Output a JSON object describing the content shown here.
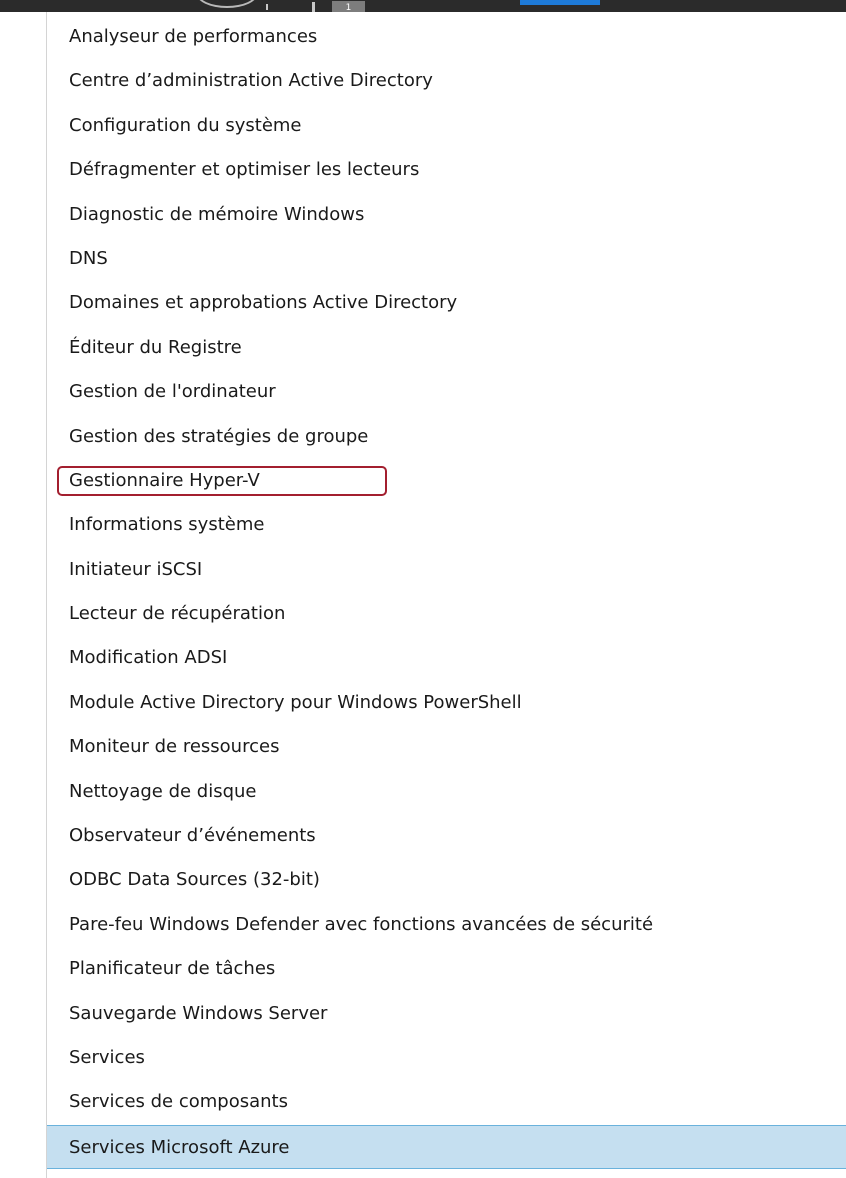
{
  "taskbar": {
    "badge_text": "1",
    "accent_color": "#1e7ad8"
  },
  "menu": {
    "highlight_color": "#a31f2f",
    "selected_color": "#c5dff0",
    "items": [
      {
        "label": "Analyseur de performances"
      },
      {
        "label": "Centre d’administration Active Directory"
      },
      {
        "label": "Configuration du système"
      },
      {
        "label": "Défragmenter et optimiser les lecteurs"
      },
      {
        "label": "Diagnostic de mémoire Windows"
      },
      {
        "label": "DNS"
      },
      {
        "label": "Domaines et approbations Active Directory"
      },
      {
        "label": "Éditeur du Registre"
      },
      {
        "label": "Gestion de l'ordinateur"
      },
      {
        "label": "Gestion des stratégies de groupe"
      },
      {
        "label": "Gestionnaire Hyper-V",
        "highlighted": true
      },
      {
        "label": "Informations système"
      },
      {
        "label": "Initiateur iSCSI"
      },
      {
        "label": "Lecteur de récupération"
      },
      {
        "label": "Modification ADSI"
      },
      {
        "label": "Module Active Directory pour Windows PowerShell"
      },
      {
        "label": "Moniteur de ressources"
      },
      {
        "label": "Nettoyage de disque"
      },
      {
        "label": "Observateur d’événements"
      },
      {
        "label": "ODBC Data Sources (32-bit)"
      },
      {
        "label": "Pare-feu Windows Defender avec fonctions avancées de sécurité"
      },
      {
        "label": "Planificateur de tâches"
      },
      {
        "label": "Sauvegarde Windows Server"
      },
      {
        "label": "Services"
      },
      {
        "label": "Services de composants"
      },
      {
        "label": "Services Microsoft Azure",
        "selected": true
      }
    ]
  }
}
